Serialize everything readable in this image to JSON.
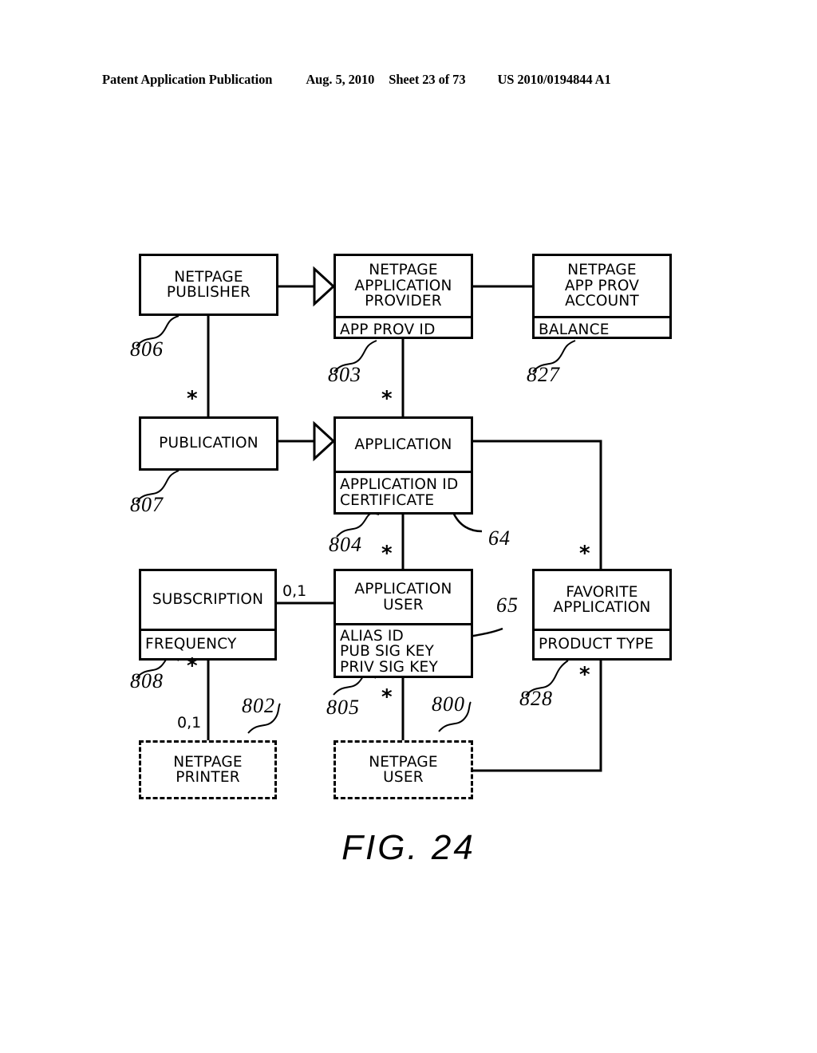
{
  "header": {
    "publication": "Patent Application Publication",
    "date": "Aug. 5, 2010",
    "sheet": "Sheet 23 of 73",
    "number": "US 2010/0194844 A1"
  },
  "figure": {
    "caption": "FIG. 24"
  },
  "entities": {
    "netpage_publisher": {
      "title": "NETPAGE\nPUBLISHER",
      "attributes": ""
    },
    "netpage_application_provider": {
      "title": "NETPAGE\nAPPLICATION\nPROVIDER",
      "attributes": "APP PROV ID"
    },
    "netpage_app_prov_account": {
      "title": "NETPAGE\nAPP PROV\nACCOUNT",
      "attributes": "BALANCE"
    },
    "publication": {
      "title": "PUBLICATION",
      "attributes": ""
    },
    "application": {
      "title": "APPLICATION",
      "attributes": "APPLICATION ID\nCERTIFICATE"
    },
    "subscription": {
      "title": "SUBSCRIPTION",
      "attributes": "FREQUENCY"
    },
    "application_user": {
      "title": "APPLICATION\nUSER",
      "attributes": "ALIAS ID\nPUB SIG KEY\nPRIV SIG KEY"
    },
    "favorite_application": {
      "title": "FAVORITE\nAPPLICATION",
      "attributes": "PRODUCT TYPE"
    },
    "netpage_printer": {
      "title": "NETPAGE\nPRINTER",
      "attributes": ""
    },
    "netpage_user": {
      "title": "NETPAGE\nUSER",
      "attributes": ""
    }
  },
  "reference_numerals": {
    "publisher": "806",
    "app_provider": "803",
    "app_prov_account": "827",
    "publication": "807",
    "application": "804",
    "certificate": "64",
    "subscription": "808",
    "application_user": "805",
    "alias_id": "65",
    "favorite_application": "828",
    "netpage_printer": "802",
    "netpage_user": "800"
  },
  "multiplicities": {
    "publisher_publication": "*",
    "provider_application": "*",
    "application_appuser": "*",
    "application_favorite": "*",
    "subscription_appuser": "0,1",
    "subscription_printer": "*",
    "printer_subscription": "0,1",
    "appuser_netpageuser": "*",
    "favorite_netpageuser": "*"
  },
  "colors": {
    "stroke": "#000000",
    "background": "#ffffff"
  }
}
